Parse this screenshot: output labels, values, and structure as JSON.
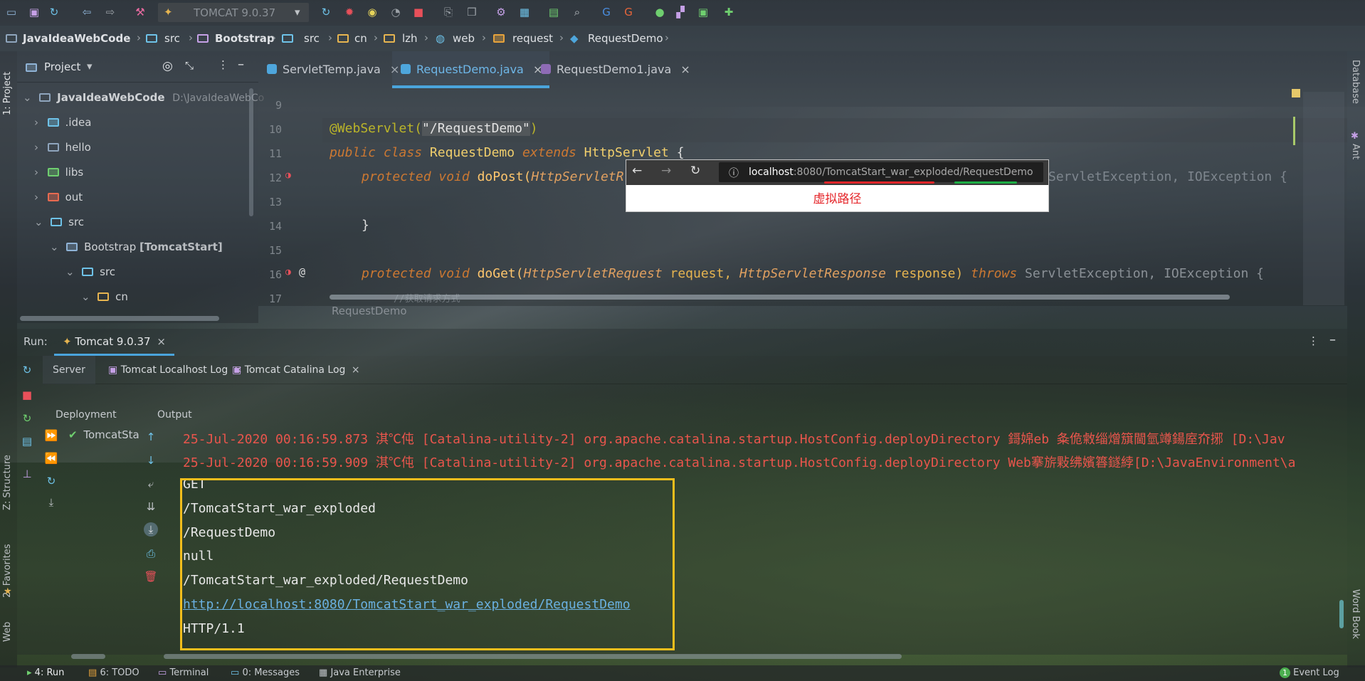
{
  "toolbar": {
    "run_config": "TOMCAT 9.0.37"
  },
  "breadcrumb": [
    "JavaIdeaWebCode",
    "src",
    "Bootstrap",
    "src",
    "cn",
    "lzh",
    "web",
    "request",
    "RequestDemo"
  ],
  "left_strip": {
    "project": "1: Project",
    "structure": "Z: Structure",
    "favorites": "2: Favorites",
    "web": "Web"
  },
  "right_strip": {
    "database": "Database",
    "ant": "Ant",
    "word_book": "Word Book"
  },
  "project_panel": {
    "title": "Project",
    "tree": [
      {
        "label": "JavaIdeaWebCode",
        "extra": "D:\\JavaIdeaWebCo"
      },
      {
        "label": ".idea"
      },
      {
        "label": "hello"
      },
      {
        "label": "libs"
      },
      {
        "label": "out"
      },
      {
        "label": "src"
      },
      {
        "label": "Bootstrap",
        "extra": "[TomcatStart]"
      },
      {
        "label": "src"
      },
      {
        "label": "cn"
      }
    ]
  },
  "editor": {
    "tabs": [
      "ServletTemp.java",
      "RequestDemo.java",
      "RequestDemo1.java"
    ],
    "line_numbers": [
      "9",
      "10",
      "11",
      "12",
      "13",
      "14",
      "15",
      "16",
      "17"
    ],
    "code": {
      "l10_ann": "@WebServlet(",
      "l10_str": "\"/RequestDemo\"",
      "l10_end": ")",
      "l11_kw1": "public class ",
      "l11_cls": "RequestDemo ",
      "l11_kw2": "extends ",
      "l11_cls2": "HttpServlet ",
      "l11_end": "{",
      "l12_kw": "protected void ",
      "l12_fn": "doPost(",
      "l12_param": "HttpServletR",
      "l12_rest": "ServletException, IOException {",
      "l14": "}",
      "l16_kw": "protected void ",
      "l16_fn": "doGet(",
      "l16_t1": "HttpServletRequest ",
      "l16_p1": "request, ",
      "l16_t2": "HttpServletResponse ",
      "l16_p2": "response) ",
      "l16_kw2": "throws ",
      "l16_rest": "ServletException, IOException {",
      "l17": "//获取请求方式"
    },
    "breadcrumb_footer": "RequestDemo"
  },
  "browser_overlay": {
    "url_host": "localhost",
    "url_rest": ":8080/TomcatStart_war_exploded/RequestDemo",
    "caption": "虚拟路径"
  },
  "run_panel": {
    "label": "Run:",
    "tab": "Tomcat 9.0.37",
    "sub_tabs": [
      "Server",
      "Tomcat Localhost Log",
      "Tomcat Catalina Log"
    ],
    "deployment_label": "Deployment",
    "output_label": "Output",
    "deployment_item": "TomcatSta",
    "log_lines": [
      "25-Jul-2020 00:16:59.873 淇℃伅 [Catalina-utility-2] org.apache.catalina.startup.HostConfig.deployDirectory 鎶婂eb 夈佹敹缁熷簱閫氫竴鍚庢夼捓 [D:\\Jav",
      "25-Jul-2020 00:16:59.909 淇℃伅 [Catalina-utility-2] org.apache.catalina.startup.HostConfig.deployDirectory Web搴旂敤绋嬪簭鐩綍[D:\\JavaEnvironment\\a"
    ],
    "output_lines": [
      "GET",
      "/TomcatStart_war_exploded",
      "/RequestDemo",
      "null",
      "/TomcatStart_war_exploded/RequestDemo",
      "http://localhost:8080/TomcatStart_war_exploded/RequestDemo",
      "HTTP/1.1"
    ]
  },
  "statusbar": {
    "run": "4: Run",
    "todo": "6: TODO",
    "terminal": "Terminal",
    "messages": "0: Messages",
    "java_enterprise": "Java Enterprise",
    "event_log": "Event Log",
    "event_count": "1"
  },
  "colors": {
    "accent": "#4aa4dc",
    "highlight_box": "#f3be1c",
    "error_red": "#e9554c",
    "link": "#6ab0e0"
  }
}
